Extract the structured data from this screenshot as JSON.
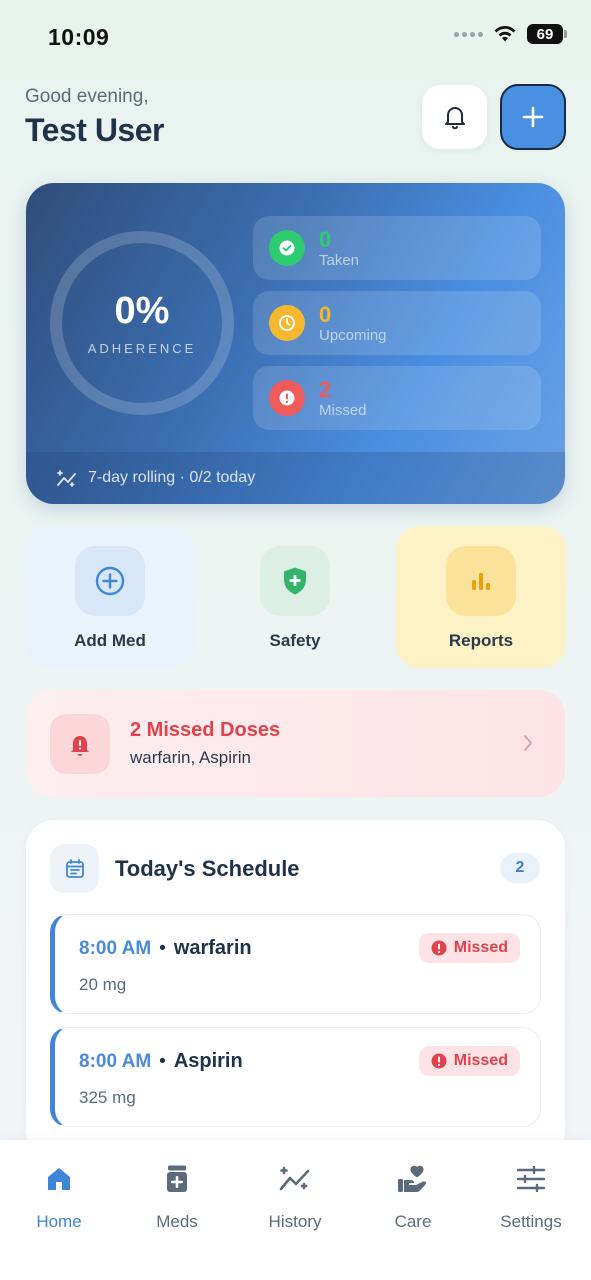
{
  "status_bar": {
    "time": "10:09",
    "battery": "69"
  },
  "header": {
    "greeting": "Good evening,",
    "user_name": "Test User"
  },
  "adherence": {
    "percent": "0%",
    "label": "ADHERENCE",
    "stats": [
      {
        "value": "0",
        "label": "Taken",
        "color": "#2ecc71",
        "icon": "check-icon"
      },
      {
        "value": "0",
        "label": "Upcoming",
        "color": "#f5b82e",
        "icon": "clock-icon"
      },
      {
        "value": "2",
        "label": "Missed",
        "color": "#ef5b5b",
        "icon": "alert-icon"
      }
    ],
    "footer": "7-day rolling · 0/2 today"
  },
  "quick_actions": [
    {
      "label": "Add Med",
      "icon": "add-circle-icon"
    },
    {
      "label": "Safety",
      "icon": "shield-icon"
    },
    {
      "label": "Reports",
      "icon": "bar-chart-icon"
    }
  ],
  "missed_alert": {
    "title": "2 Missed Doses",
    "subtitle": "warfarin, Aspirin"
  },
  "schedule": {
    "title": "Today's Schedule",
    "count": "2",
    "doses": [
      {
        "time": "8:00 AM",
        "separator": "•",
        "name": "warfarin",
        "amount": "20 mg",
        "status": "Missed"
      },
      {
        "time": "8:00 AM",
        "separator": "•",
        "name": "Aspirin",
        "amount": "325 mg",
        "status": "Missed"
      }
    ]
  },
  "nav": [
    {
      "label": "Home",
      "active": true
    },
    {
      "label": "Meds",
      "active": false
    },
    {
      "label": "History",
      "active": false
    },
    {
      "label": "Care",
      "active": false
    },
    {
      "label": "Settings",
      "active": false
    }
  ],
  "colors": {
    "accent": "#4a90e2",
    "missed": "#e0434b",
    "active_nav": "#3f86d9"
  }
}
